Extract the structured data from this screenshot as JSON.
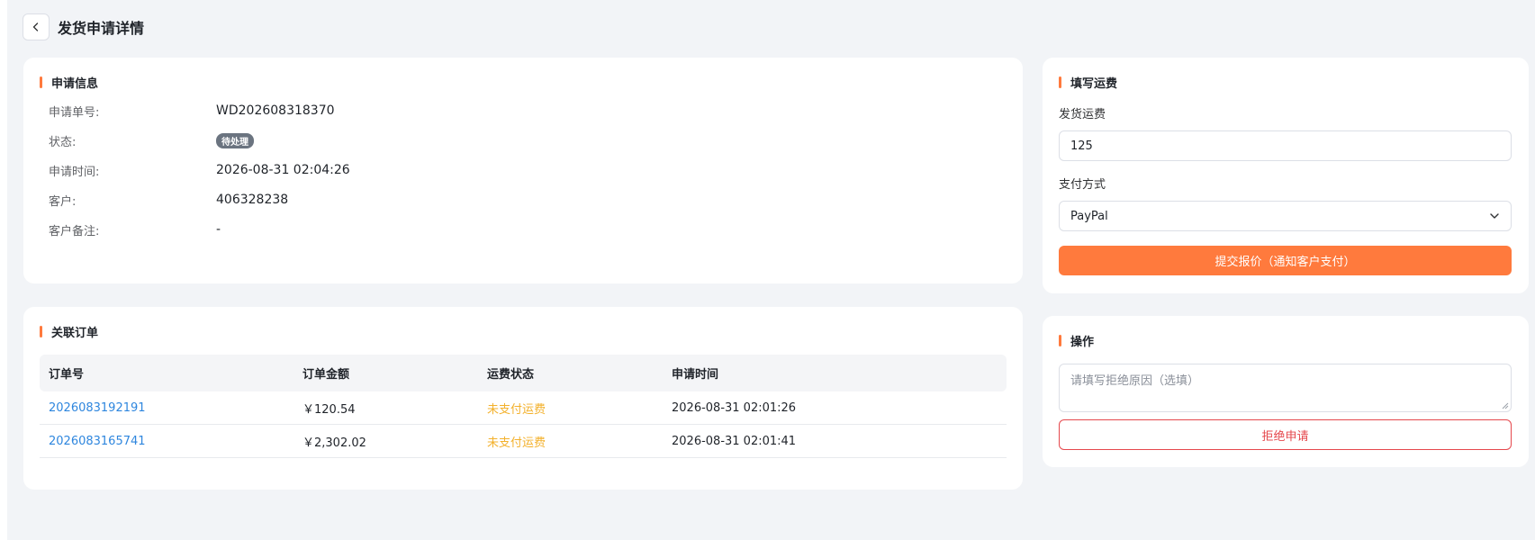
{
  "header": {
    "back_icon": "chevron-left-icon",
    "title": "发货申请详情"
  },
  "info": {
    "title": "申请信息",
    "rows": [
      {
        "label": "申请单号:",
        "value": "WD202608318370"
      },
      {
        "label": "状态:",
        "value": "待处理"
      },
      {
        "label": "申请时间:",
        "value": "2026-08-31 02:04:26"
      },
      {
        "label": "客户:",
        "value": "406328238"
      },
      {
        "label": "客户备注:",
        "value": "-"
      }
    ]
  },
  "orders": {
    "title": "关联订单",
    "columns": [
      "订单号",
      "订单金额",
      "运费状态",
      "申请时间"
    ],
    "rows": [
      {
        "order_no": "2026083192191",
        "amount": "￥120.54",
        "freight_status": "未支付运费",
        "time": "2026-08-31 02:01:26"
      },
      {
        "order_no": "2026083165741",
        "amount": "￥2,302.02",
        "freight_status": "未支付运费",
        "time": "2026-08-31 02:01:41"
      }
    ]
  },
  "freight": {
    "title": "填写运费",
    "fee_label": "发货运费",
    "fee_value": "125",
    "payment_label": "支付方式",
    "payment_value": "PayPal",
    "submit_label": "提交报价（通知客户支付）"
  },
  "operation": {
    "title": "操作",
    "reason_placeholder": "请填写拒绝原因（选填）",
    "reject_label": "拒绝申请"
  },
  "colors": {
    "accent": "#ff7a3d",
    "link": "#2e86de",
    "warning": "#f3b12c",
    "danger": "#e5484d",
    "badge": "#6b7480"
  }
}
